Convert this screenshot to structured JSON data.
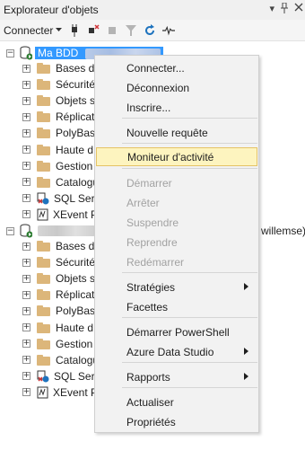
{
  "window": {
    "title": "Explorateur d'objets",
    "controls": [
      "▾",
      "📌",
      "✕"
    ]
  },
  "toolbar": {
    "connect_label": "Connecter",
    "icons": [
      "connect-plug-icon",
      "disconnect-icon",
      "stop-icon",
      "filter-icon",
      "refresh-icon",
      "activity-monitor-icon"
    ]
  },
  "tree": {
    "server1": {
      "label": "Ma BDD",
      "children": [
        "Bases de",
        "Sécurité",
        "Objets s",
        "Réplicati",
        "PolyBase",
        "Haute d",
        "Gestion",
        "Catalogu",
        "SQL Serv",
        "XEvent P"
      ]
    },
    "server2": {
      "suffix": "willemse)",
      "children": [
        "Bases de",
        "Sécurité",
        "Objets s",
        "Réplicati",
        "PolyBase",
        "Haute d",
        "Gestion",
        "Catalogu",
        "SQL Serv",
        "XEvent P"
      ]
    }
  },
  "context_menu": {
    "items": [
      {
        "label": "Connecter...",
        "enabled": true
      },
      {
        "label": "Déconnexion",
        "enabled": true
      },
      {
        "label": "Inscrire...",
        "enabled": true
      },
      {
        "label": "Nouvelle requête",
        "enabled": true
      },
      {
        "label": "Moniteur d'activité",
        "enabled": true,
        "highlighted": true
      },
      {
        "label": "Démarrer",
        "enabled": false
      },
      {
        "label": "Arrêter",
        "enabled": false
      },
      {
        "label": "Suspendre",
        "enabled": false
      },
      {
        "label": "Reprendre",
        "enabled": false
      },
      {
        "label": "Redémarrer",
        "enabled": false
      },
      {
        "label": "Stratégies",
        "enabled": true,
        "submenu": true
      },
      {
        "label": "Facettes",
        "enabled": true
      },
      {
        "label": "Démarrer PowerShell",
        "enabled": true
      },
      {
        "label": "Azure Data Studio",
        "enabled": true,
        "submenu": true
      },
      {
        "label": "Rapports",
        "enabled": true,
        "submenu": true
      },
      {
        "label": "Actualiser",
        "enabled": true
      },
      {
        "label": "Propriétés",
        "enabled": true
      }
    ]
  },
  "colors": {
    "selection": "#3399ff",
    "folder": "#dcb67a",
    "menu_hover_bg": "#fdf4bf",
    "menu_hover_border": "#e5c365",
    "disabled_text": "#a2a2a2"
  }
}
